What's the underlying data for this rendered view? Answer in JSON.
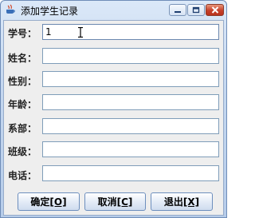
{
  "window": {
    "title": "添加学生记录"
  },
  "form": {
    "fields": [
      {
        "label": "学号：",
        "value": "1"
      },
      {
        "label": "姓名：",
        "value": ""
      },
      {
        "label": "性别：",
        "value": ""
      },
      {
        "label": "年龄：",
        "value": ""
      },
      {
        "label": "系部：",
        "value": ""
      },
      {
        "label": "班级：",
        "value": ""
      },
      {
        "label": "电话：",
        "value": ""
      }
    ]
  },
  "buttons": {
    "confirm": {
      "text": "确定",
      "mnemonic": "[O]"
    },
    "cancel": {
      "text": "取消",
      "mnemonic": "[C]"
    },
    "exit": {
      "text": "退出",
      "mnemonic": "[X]"
    }
  },
  "colors": {
    "titlebar": "#c4d7ef",
    "client_bg": "#eeeeee",
    "close_button": "#c6402a"
  },
  "icons": [
    "java-cup-icon",
    "minimize-icon",
    "maximize-icon",
    "close-icon",
    "text-cursor-icon"
  ]
}
